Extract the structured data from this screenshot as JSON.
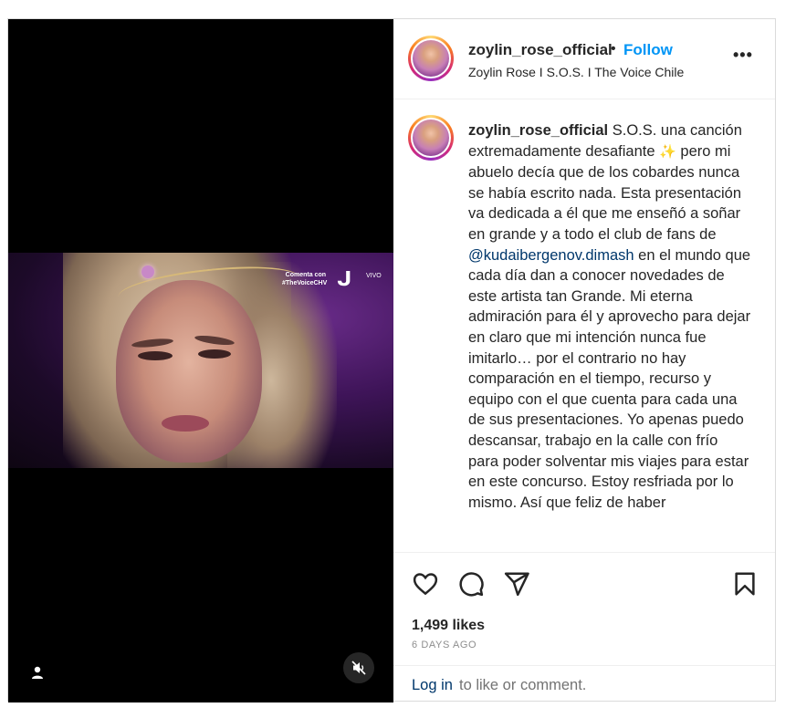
{
  "post": {
    "username": "zoylin_rose_official",
    "separator": "•",
    "follow_label": "Follow",
    "subtitle": "Zoylin Rose I S.O.S. I The Voice Chile",
    "more_label": "•••",
    "video": {
      "overlay_text_line1": "Comenta con",
      "overlay_text_line2": "#TheVoiceCHV",
      "overlay_logo": "ᒍ",
      "overlay_live": "VIVO"
    },
    "icons": {
      "user_tag": "user-tag-icon",
      "mute": "speaker-muted-icon",
      "like": "heart-icon",
      "comment": "comment-bubble-icon",
      "share": "paper-plane-icon",
      "save": "bookmark-icon"
    },
    "caption": {
      "username": "zoylin_rose_official",
      "part1": " S.O.S. una canción extremadamente desafiante ",
      "emoji": "✨",
      "part2": " pero mi abuelo decía que de los cobardes nunca se había escrito nada. Esta presentación va dedicada a él que me enseñó a soñar en grande y a todo el club de fans de ",
      "mention": "@kudaibergenov.dimash",
      "part3": " en el mundo que cada día dan a conocer novedades de este artista tan Grande. Mi eterna admiración para él y aprovecho para dejar en claro que mi intención nunca fue imitarlo… por el contrario no hay comparación en el tiempo, recurso y equipo con el que cuenta para cada una de sus presentaciones. Yo apenas puedo descansar, trabajo en la calle con frío para poder solventar mis viajes para estar en este concurso. Estoy resfriada por lo mismo. Así que feliz de haber"
    },
    "likes": "1,499 likes",
    "date": "6 DAYS AGO",
    "login_link": "Log in",
    "login_rest": "to like or comment."
  },
  "colors": {
    "follow_blue": "#0095f6",
    "mention_blue": "#00376b",
    "text": "#262626",
    "muted": "#8e8e8e",
    "border": "#dbdbdb"
  }
}
